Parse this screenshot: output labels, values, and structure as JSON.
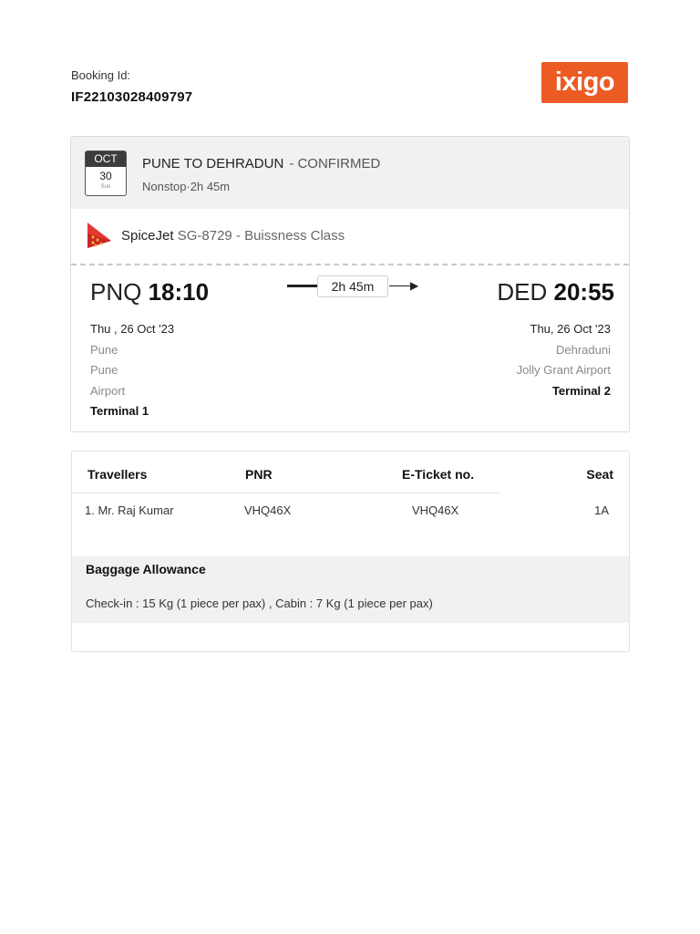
{
  "booking": {
    "label": "Booking Id:",
    "id": "IF22103028409797"
  },
  "brand": {
    "logo_text": "ixigo",
    "color": "#ec5b24"
  },
  "trip": {
    "date": {
      "month": "OCT",
      "day": "30",
      "weekday": "Sun"
    },
    "route": "PUNE TO DEHRADUN",
    "status": "- CONFIRMED",
    "summary": "Nonstop·2h 45m"
  },
  "airline": {
    "name": "SpiceJet",
    "flight": "SG-8729 - Buissness Class",
    "icon": "spicejet-logo"
  },
  "departure": {
    "code": "PNQ",
    "time": "18:10",
    "date": "Thu , 26 Oct '23",
    "city": "Pune",
    "airport_line1": "Pune",
    "airport_line2": "Airport",
    "terminal": "Terminal 1"
  },
  "duration": "2h 45m",
  "arrival": {
    "code": "DED",
    "time": "20:55",
    "date": "Thu, 26 Oct '23",
    "city": "Dehraduni",
    "airport": "Jolly Grant Airport",
    "terminal": "Terminal 2"
  },
  "travellers": {
    "headers": {
      "name": "Travellers",
      "pnr": "PNR",
      "ticket": "E-Ticket no.",
      "seat": "Seat"
    },
    "rows": [
      {
        "name": "1. Mr. Raj Kumar",
        "pnr": "VHQ46X",
        "ticket": "VHQ46X",
        "seat": "1A"
      }
    ]
  },
  "baggage": {
    "title": "Baggage Allowance",
    "text": "Check-in : 15 Kg (1 piece per pax) , Cabin : 7 Kg (1 piece per pax)"
  }
}
